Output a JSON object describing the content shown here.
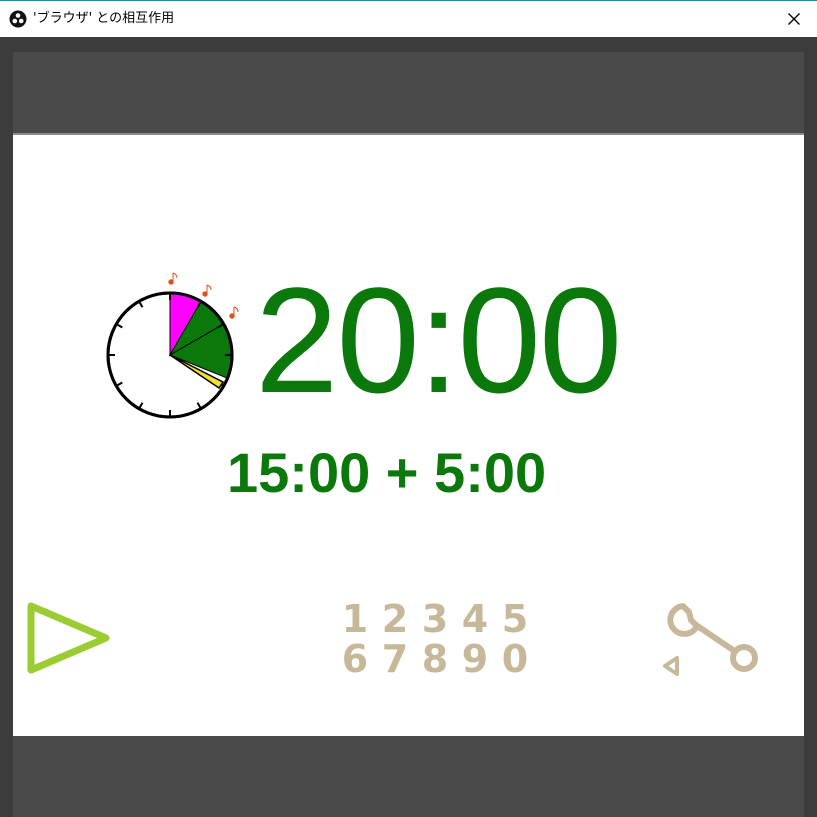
{
  "window": {
    "title": "'ブラウザ' との相互作用",
    "app_icon": "obs-icon",
    "close_icon": "close-icon"
  },
  "timer": {
    "main_time": "20:00",
    "breakdown": "15:00 + 5:00",
    "clock_icon": "clock-icon",
    "colors": {
      "main": "#0a780a",
      "phase1": "#ff00ff",
      "phase2": "#0a780a",
      "hand": "#f0e030",
      "bell": "#e05020"
    }
  },
  "controls": {
    "play_icon": "play-icon",
    "digits": [
      "1",
      "2",
      "3",
      "4",
      "5",
      "6",
      "7",
      "8",
      "9",
      "0"
    ],
    "settings_icon": "wrench-icon",
    "colors": {
      "play": "#9acd32",
      "digits": "#c8b89a",
      "settings": "#c8b89a"
    }
  }
}
